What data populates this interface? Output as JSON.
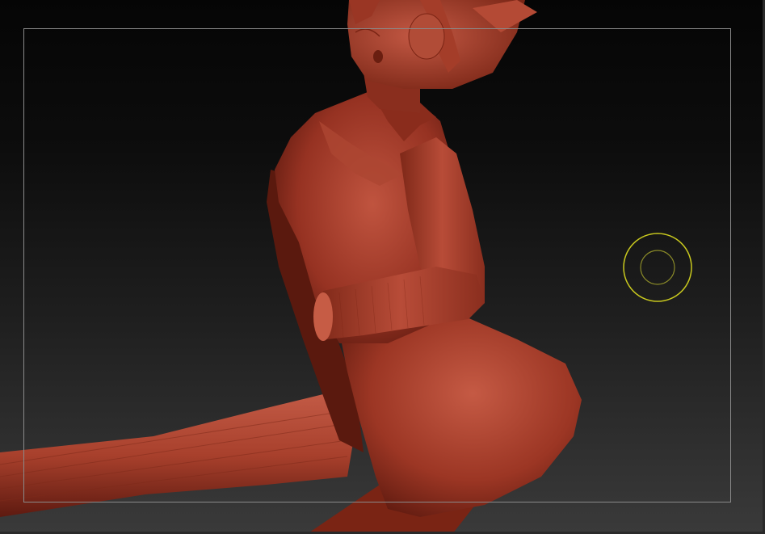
{
  "app": {
    "name": "",
    "window_title": ""
  },
  "viewport": {
    "background_top": "#050505",
    "background_bottom": "#3a3a3a",
    "frame_border_color": "#8a8a8a",
    "model_color": "#9c3624",
    "model_highlight": "#c55a44",
    "model_shadow": "#4a140c"
  },
  "brush": {
    "outer_color": "#c8c81e",
    "inner_color": "#8a8a28",
    "icon": "draw-size-circle-icon"
  },
  "model": {
    "icon": "sculpt-figure"
  }
}
